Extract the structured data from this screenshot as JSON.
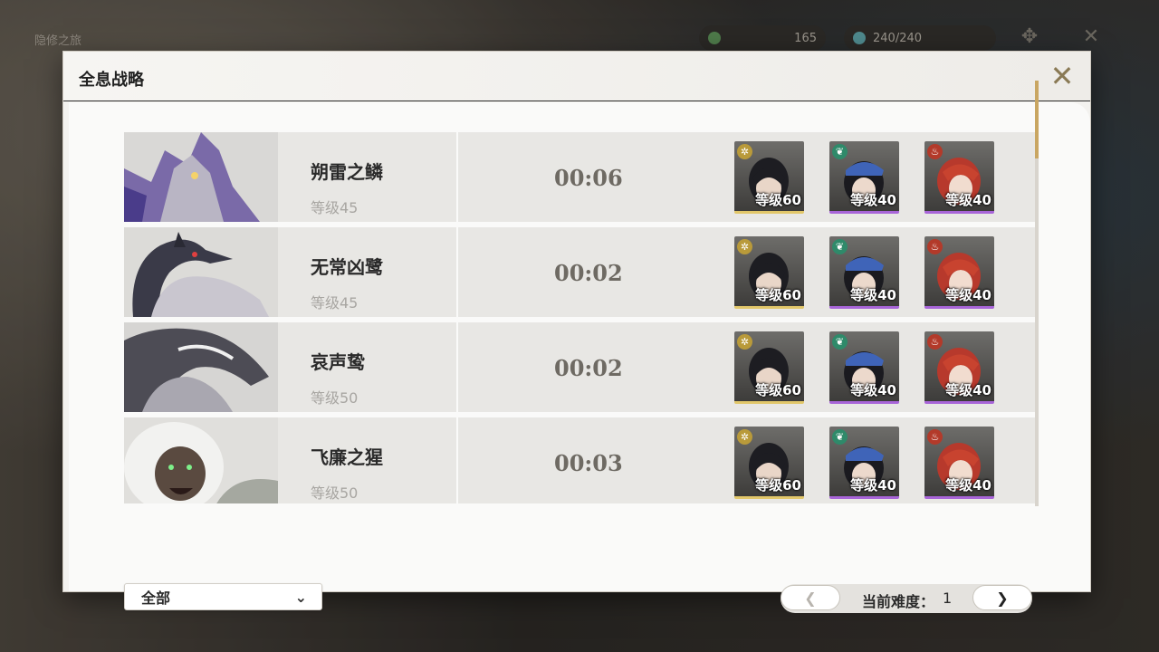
{
  "topbar": {
    "left_text": "隐修之旅",
    "currency_a": "165",
    "currency_b": "240/240"
  },
  "modal": {
    "title": "全息战略"
  },
  "bosses": [
    {
      "name": "朔雷之鳞",
      "level": "等级45",
      "time": "00:06",
      "team": [
        {
          "level": "等级60",
          "element": "spectro",
          "rarity": "gold"
        },
        {
          "level": "等级40",
          "element": "aero",
          "rarity": "purple"
        },
        {
          "level": "等级40",
          "element": "fusion",
          "rarity": "purple"
        }
      ]
    },
    {
      "name": "无常凶鹭",
      "level": "等级45",
      "time": "00:02",
      "team": [
        {
          "level": "等级60",
          "element": "spectro",
          "rarity": "gold"
        },
        {
          "level": "等级40",
          "element": "aero",
          "rarity": "purple"
        },
        {
          "level": "等级40",
          "element": "fusion",
          "rarity": "purple"
        }
      ]
    },
    {
      "name": "哀声鸷",
      "level": "等级50",
      "time": "00:02",
      "team": [
        {
          "level": "等级60",
          "element": "spectro",
          "rarity": "gold"
        },
        {
          "level": "等级40",
          "element": "aero",
          "rarity": "purple"
        },
        {
          "level": "等级40",
          "element": "fusion",
          "rarity": "purple"
        }
      ]
    },
    {
      "name": "飞廉之猩",
      "level": "等级50",
      "time": "00:03",
      "team": [
        {
          "level": "等级60",
          "element": "spectro",
          "rarity": "gold"
        },
        {
          "level": "等级40",
          "element": "aero",
          "rarity": "purple"
        },
        {
          "level": "等级40",
          "element": "fusion",
          "rarity": "purple"
        }
      ]
    }
  ],
  "filter": {
    "selected": "全部"
  },
  "pager": {
    "prev": "❮",
    "next": "❯",
    "label": "当前难度：",
    "value": "1"
  },
  "colors": {
    "gold": "#e2c76a",
    "purple": "#a865d8",
    "accent": "#c9a662"
  }
}
